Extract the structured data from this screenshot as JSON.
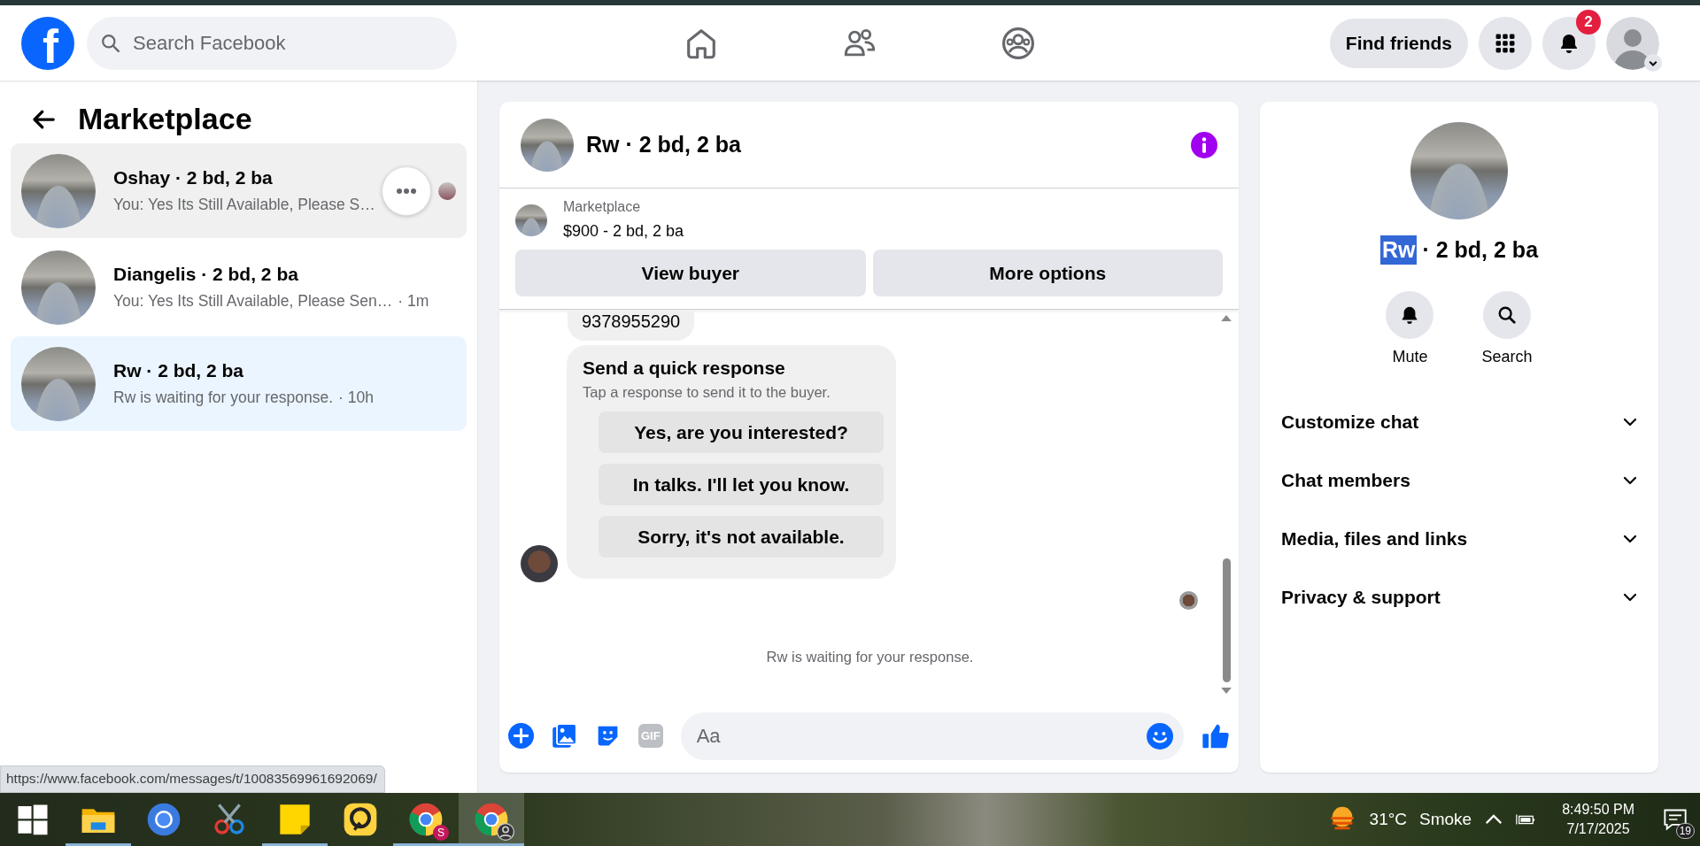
{
  "header": {
    "logo": "f",
    "search": {
      "placeholder": "Search Facebook"
    },
    "nav": [
      {
        "kind": "home"
      },
      {
        "kind": "friends"
      },
      {
        "kind": "groups"
      }
    ],
    "find_friends": "Find friends",
    "notifications_badge": "2"
  },
  "sidebar": {
    "title": "Marketplace",
    "conversations": [
      {
        "name": "Oshay · 2 bd, 2 ba",
        "preview": "You: Yes Its Still Available, Please S…",
        "hovered": true,
        "selected": false,
        "seen": true
      },
      {
        "name": "Diangelis · 2 bd, 2 ba",
        "preview": "You: Yes Its Still Available, Please Sen…",
        "time": "· 1m",
        "hovered": false,
        "selected": false,
        "seen": false
      },
      {
        "name": "Rw · 2 bd, 2 ba",
        "preview": "Rw is waiting for your response.",
        "time": "· 10h",
        "hovered": false,
        "selected": true,
        "seen": false
      }
    ]
  },
  "chat": {
    "title": "Rw · 2 bd, 2 ba",
    "listing": {
      "label": "Marketplace",
      "price": "$900 - 2 bd, 2 ba"
    },
    "actions": [
      "View buyer",
      "More options"
    ],
    "messages": [
      {
        "kind": "text",
        "text": "9378955290"
      },
      {
        "kind": "quick_response",
        "title": "Send a quick response",
        "subtitle": "Tap a response to send it to the buyer.",
        "options": [
          "Yes, are you interested?",
          "In talks. I'll let you know.",
          "Sorry, it's not available."
        ]
      }
    ],
    "notice": "Rw is waiting for your response.",
    "composer": {
      "gif": "GIF",
      "placeholder": "Aa"
    }
  },
  "details": {
    "name": "Rw",
    "name_selected": true,
    "suffix": "· 2 bd, 2 ba",
    "actions": [
      {
        "kind": "mute",
        "label": "Mute"
      },
      {
        "kind": "search",
        "label": "Search"
      }
    ],
    "sections": [
      {
        "label": "Customize chat",
        "expanded": false
      },
      {
        "label": "Chat members",
        "expanded": false
      },
      {
        "label": "Media, files and links",
        "expanded": false
      },
      {
        "label": "Privacy & support",
        "expanded": false
      }
    ]
  },
  "status_url": "https://www.facebook.com/messages/t/10083569961692069/",
  "taskbar": {
    "apps": [
      {
        "kind": "start",
        "running": false,
        "active": false
      },
      {
        "kind": "explorer",
        "running": true,
        "active": false
      },
      {
        "kind": "chromium",
        "running": false,
        "active": false
      },
      {
        "kind": "snipping",
        "running": false,
        "active": false
      },
      {
        "kind": "sticky",
        "running": true,
        "active": false
      },
      {
        "kind": "gamepad",
        "running": false,
        "active": false
      },
      {
        "kind": "chrome",
        "badge": "S",
        "running": true,
        "active": false
      },
      {
        "kind": "chrome",
        "running": true,
        "active": true
      }
    ],
    "weather": {
      "temp": "31°C",
      "condition": "Smoke"
    },
    "time": "8:49:50 PM",
    "date": "7/17/2025",
    "notifications": "19"
  }
}
